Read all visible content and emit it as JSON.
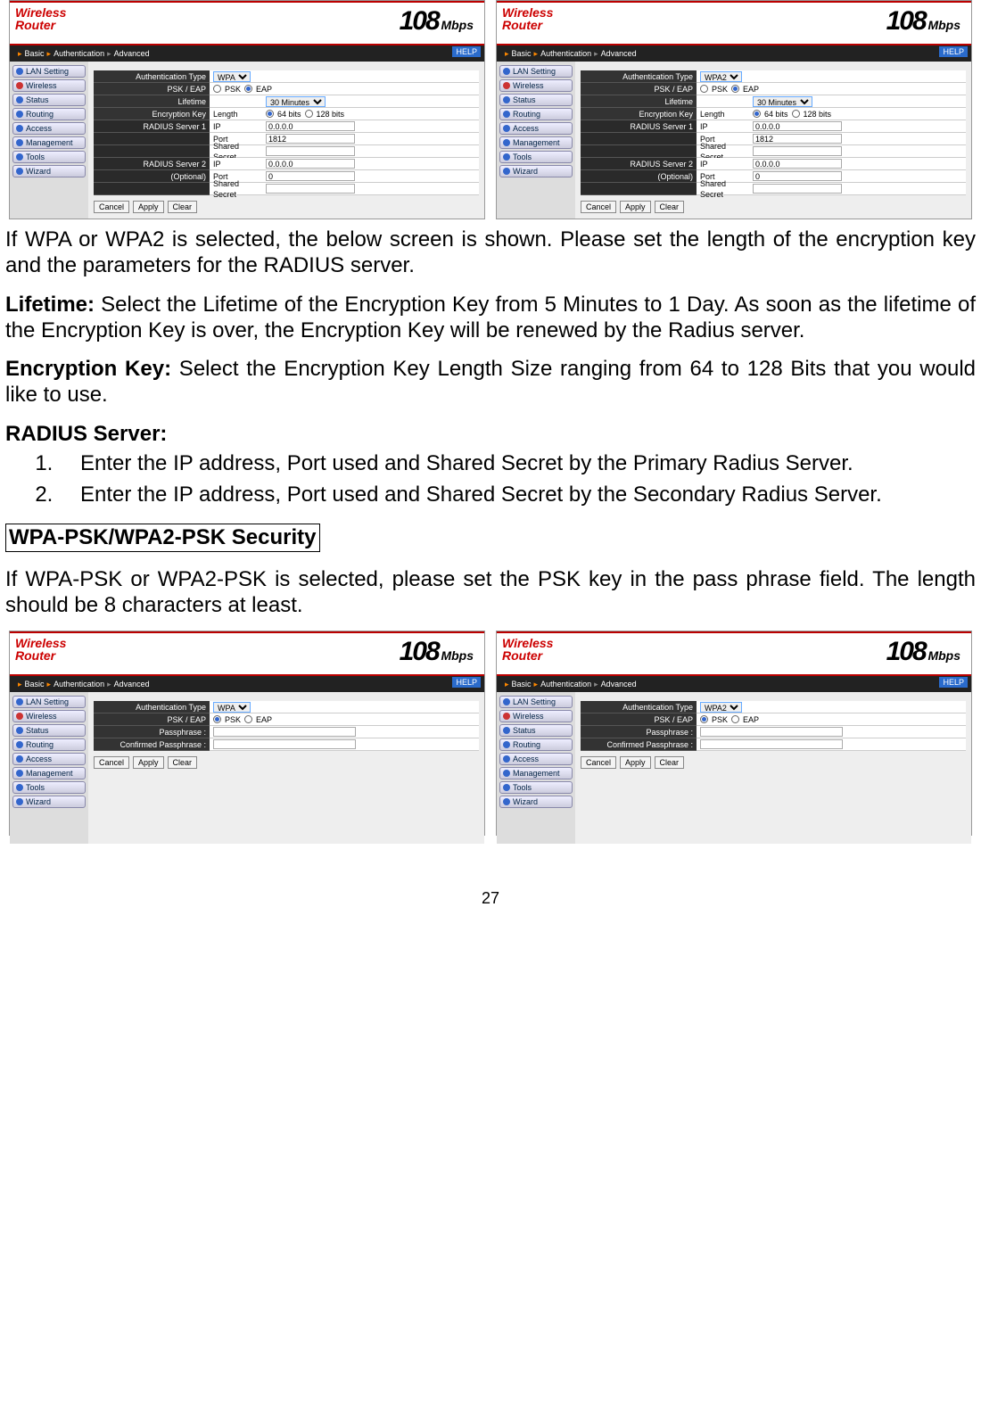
{
  "logo": {
    "line1": "Wireless",
    "line2": "Router",
    "speed_big": "108",
    "speed_unit": "Mbps"
  },
  "nav": {
    "basic": "Basic",
    "auth": "Authentication",
    "adv": "Advanced",
    "help": "HELP"
  },
  "sidebar": {
    "items": [
      {
        "label": "LAN Setting"
      },
      {
        "label": "Wireless"
      },
      {
        "label": "Status"
      },
      {
        "label": "Routing"
      },
      {
        "label": "Access"
      },
      {
        "label": "Management"
      },
      {
        "label": "Tools"
      },
      {
        "label": "Wizard"
      }
    ]
  },
  "form": {
    "auth_type_label": "Authentication Type",
    "auth_type_wpa": "WPA",
    "auth_type_wpa2": "WPA2",
    "psk_eap_label": "PSK / EAP",
    "psk": "PSK",
    "eap": "EAP",
    "lifetime_label": "Lifetime",
    "lifetime_val": "30 Minutes",
    "enc_key_label": "Encryption Key",
    "length": "Length",
    "len64": "64 bits",
    "len128": "128 bits",
    "radius1_label": "RADIUS Server 1",
    "radius2_label": "RADIUS Server 2",
    "optional": "(Optional)",
    "ip": "IP",
    "ip_val": "0.0.0.0",
    "port": "Port",
    "port_val_1": "1812",
    "port_val_2": "0",
    "secret": "Shared Secret",
    "passphrase": "Passphrase :",
    "confirm_pass": "Confirmed Passphrase :"
  },
  "buttons": {
    "cancel": "Cancel",
    "apply": "Apply",
    "clear": "Clear"
  },
  "text": {
    "p1": "If WPA or WPA2 is selected, the below screen is shown.  Please set the length of the encryption key and the parameters for the RADIUS server.",
    "p2a": "Lifetime:",
    "p2b": " Select the Lifetime of the Encryption Key from 5 Minutes to 1 Day.  As soon as the lifetime of the Encryption Key is over, the Encryption Key will be renewed by the Radius server.",
    "p3a": "Encryption Key:",
    "p3b": " Select the Encryption Key Length Size ranging from 64 to 128 Bits that you would like to use.",
    "p4": "RADIUS Server:",
    "li1": "Enter the IP address, Port used and Shared Secret by the Primary Radius Server.",
    "li2": "Enter the IP address, Port used and Shared Secret by the Secondary Radius Server.",
    "h2": "WPA-PSK/WPA2-PSK Security",
    "p5": "If WPA-PSK or WPA2-PSK is selected, please set the PSK key in the pass phrase field. The length should be 8 characters at least."
  },
  "page_number": "27"
}
